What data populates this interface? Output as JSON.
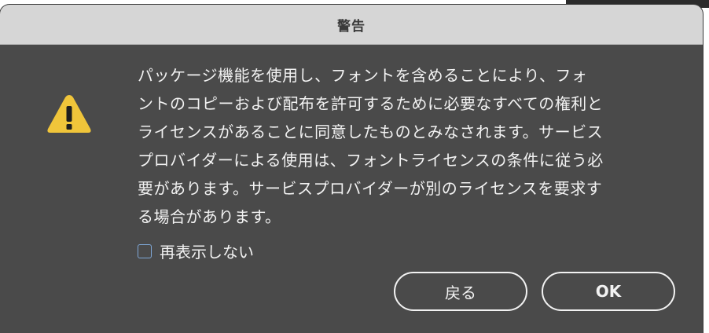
{
  "dialog": {
    "title": "警告",
    "icon": "warning-triangle-icon",
    "message": "パッケージ機能を使用し、フォントを含めることにより、フォ\nントのコピーおよび配布を許可するために必要なすべての権利と\nライセンスがあることに同意したものとみなされます。サービス\nプロバイダーによる使用は、フォントライセンスの条件に従う必\n要があります。サービスプロバイダーが別のライセンスを要求す\nる場合があります。",
    "checkbox_label": "再表示しない",
    "checkbox_checked": false,
    "back_button": "戻る",
    "ok_button": "OK"
  },
  "colors": {
    "dialog_bg": "#4a4a4a",
    "titlebar_bg": "#d6d6d6",
    "warning_yellow": "#f0c53a",
    "checkbox_border": "#7fa8d8"
  }
}
